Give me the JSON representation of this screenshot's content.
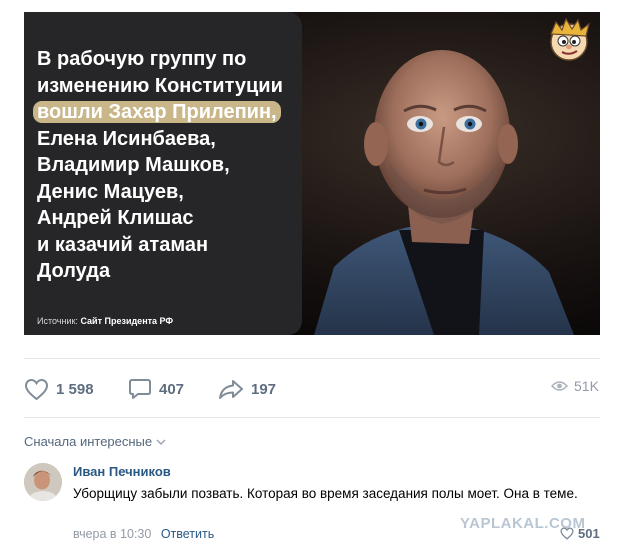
{
  "post": {
    "headline": [
      "В рабочую группу по",
      "изменению Конституции",
      "вошли Захар Прилепин,",
      "Елена Исинбаева,",
      "Владимир Машков,",
      "Денис Мацуев,",
      "Андрей Клишас",
      "и казачий атаман",
      "Долуда"
    ],
    "highlight_color": "#c9b78a",
    "card_color": "#262628",
    "source_label": "Источник:",
    "source_value": "Сайт Президента РФ"
  },
  "actions": {
    "likes": "1 598",
    "comments": "407",
    "shares": "197",
    "views": "51K"
  },
  "comments": {
    "sort_label": "Сначала интересные",
    "items": [
      {
        "author": "Иван Печников",
        "text": "Уборщицу забыли позвать. Которая во время заседания полы моет. Она в теме.",
        "time": "вчера в 10:30",
        "reply_label": "Ответить",
        "likes": "501"
      }
    ]
  },
  "watermark": "YAPLAKAL.COM",
  "colors": {
    "link": "#2a5885",
    "icon": "#818c99",
    "muted": "#939ba5"
  }
}
